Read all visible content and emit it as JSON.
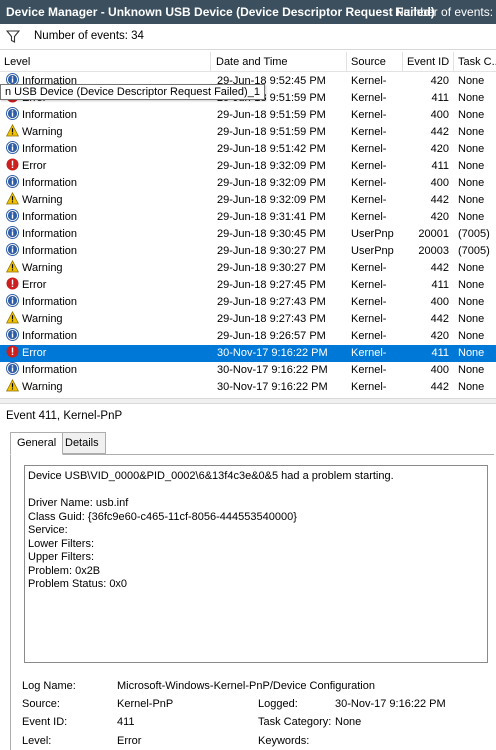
{
  "title_bar": {
    "title": "Device Manager - Unknown USB Device (Device Descriptor Request Failed)",
    "event_count": "Number of events: 34"
  },
  "filter_bar": {
    "icon": "funnel-icon",
    "label": "Number of events: 34"
  },
  "columns": [
    "Level",
    "Date and Time",
    "Source",
    "Event ID",
    "Task C..."
  ],
  "tooltip": "n USB Device (Device Descriptor Request Failed)_1",
  "rows": [
    {
      "level": "Information",
      "icon": "info-icon",
      "date": "29-Jun-18 9:52:45 PM",
      "source": "Kernel-",
      "id": "420",
      "task": "None"
    },
    {
      "level": "Error",
      "icon": "error-icon",
      "date": "29-Jun-18 9:51:59 PM",
      "source": "Kernel-",
      "id": "411",
      "task": "None"
    },
    {
      "level": "Information",
      "icon": "info-icon",
      "date": "29-Jun-18 9:51:59 PM",
      "source": "Kernel-",
      "id": "400",
      "task": "None"
    },
    {
      "level": "Warning",
      "icon": "warning-icon",
      "date": "29-Jun-18 9:51:59 PM",
      "source": "Kernel-",
      "id": "442",
      "task": "None"
    },
    {
      "level": "Information",
      "icon": "info-icon",
      "date": "29-Jun-18 9:51:42 PM",
      "source": "Kernel-",
      "id": "420",
      "task": "None"
    },
    {
      "level": "Error",
      "icon": "error-icon",
      "date": "29-Jun-18 9:32:09 PM",
      "source": "Kernel-",
      "id": "411",
      "task": "None"
    },
    {
      "level": "Information",
      "icon": "info-icon",
      "date": "29-Jun-18 9:32:09 PM",
      "source": "Kernel-",
      "id": "400",
      "task": "None"
    },
    {
      "level": "Warning",
      "icon": "warning-icon",
      "date": "29-Jun-18 9:32:09 PM",
      "source": "Kernel-",
      "id": "442",
      "task": "None"
    },
    {
      "level": "Information",
      "icon": "info-icon",
      "date": "29-Jun-18 9:31:41 PM",
      "source": "Kernel-",
      "id": "420",
      "task": "None"
    },
    {
      "level": "Information",
      "icon": "info-icon",
      "date": "29-Jun-18 9:30:45 PM",
      "source": "UserPnp",
      "id": "20001",
      "task": "(7005)"
    },
    {
      "level": "Information",
      "icon": "info-icon",
      "date": "29-Jun-18 9:30:27 PM",
      "source": "UserPnp",
      "id": "20003",
      "task": "(7005)"
    },
    {
      "level": "Warning",
      "icon": "warning-icon",
      "date": "29-Jun-18 9:30:27 PM",
      "source": "Kernel-",
      "id": "442",
      "task": "None"
    },
    {
      "level": "Error",
      "icon": "error-icon",
      "date": "29-Jun-18 9:27:45 PM",
      "source": "Kernel-",
      "id": "411",
      "task": "None"
    },
    {
      "level": "Information",
      "icon": "info-icon",
      "date": "29-Jun-18 9:27:43 PM",
      "source": "Kernel-",
      "id": "400",
      "task": "None"
    },
    {
      "level": "Warning",
      "icon": "warning-icon",
      "date": "29-Jun-18 9:27:43 PM",
      "source": "Kernel-",
      "id": "442",
      "task": "None"
    },
    {
      "level": "Information",
      "icon": "info-icon",
      "date": "29-Jun-18 9:26:57 PM",
      "source": "Kernel-",
      "id": "420",
      "task": "None"
    },
    {
      "level": "Error",
      "icon": "error-icon",
      "date": "30-Nov-17 9:16:22 PM",
      "source": "Kernel-",
      "id": "411",
      "task": "None",
      "selected": true
    },
    {
      "level": "Information",
      "icon": "info-icon",
      "date": "30-Nov-17 9:16:22 PM",
      "source": "Kernel-",
      "id": "400",
      "task": "None"
    },
    {
      "level": "Warning",
      "icon": "warning-icon",
      "date": "30-Nov-17 9:16:22 PM",
      "source": "Kernel-",
      "id": "442",
      "task": "None"
    }
  ],
  "detail": {
    "title": "Event 411, Kernel-PnP",
    "tabs": [
      "General",
      "Details"
    ],
    "active_tab": "General",
    "description": [
      "Device USB\\VID_0000&PID_0002\\6&13f4c3e&0&5 had a problem starting.",
      "",
      "Driver Name: usb.inf",
      "Class Guid: {36fc9e60-c465-11cf-8056-444553540000}",
      "Service:",
      "Lower Filters:",
      "Upper Filters:",
      "Problem: 0x2B",
      "Problem Status: 0x0"
    ],
    "props": {
      "log_name_label": "Log Name:",
      "log_name": "Microsoft-Windows-Kernel-PnP/Device Configuration",
      "source_label": "Source:",
      "source": "Kernel-PnP",
      "logged_label": "Logged:",
      "logged": "30-Nov-17 9:16:22 PM",
      "event_id_label": "Event ID:",
      "event_id": "411",
      "task_category_label": "Task Category:",
      "task_category": "None",
      "level_label": "Level:",
      "level": "Error",
      "keywords_label": "Keywords:",
      "keywords": ""
    }
  },
  "colors": {
    "title_bg": "#3c4f5e",
    "selection": "#0078d7",
    "info": "#2f5ea8",
    "error": "#cc1f1f",
    "warning": "#f2c200"
  }
}
